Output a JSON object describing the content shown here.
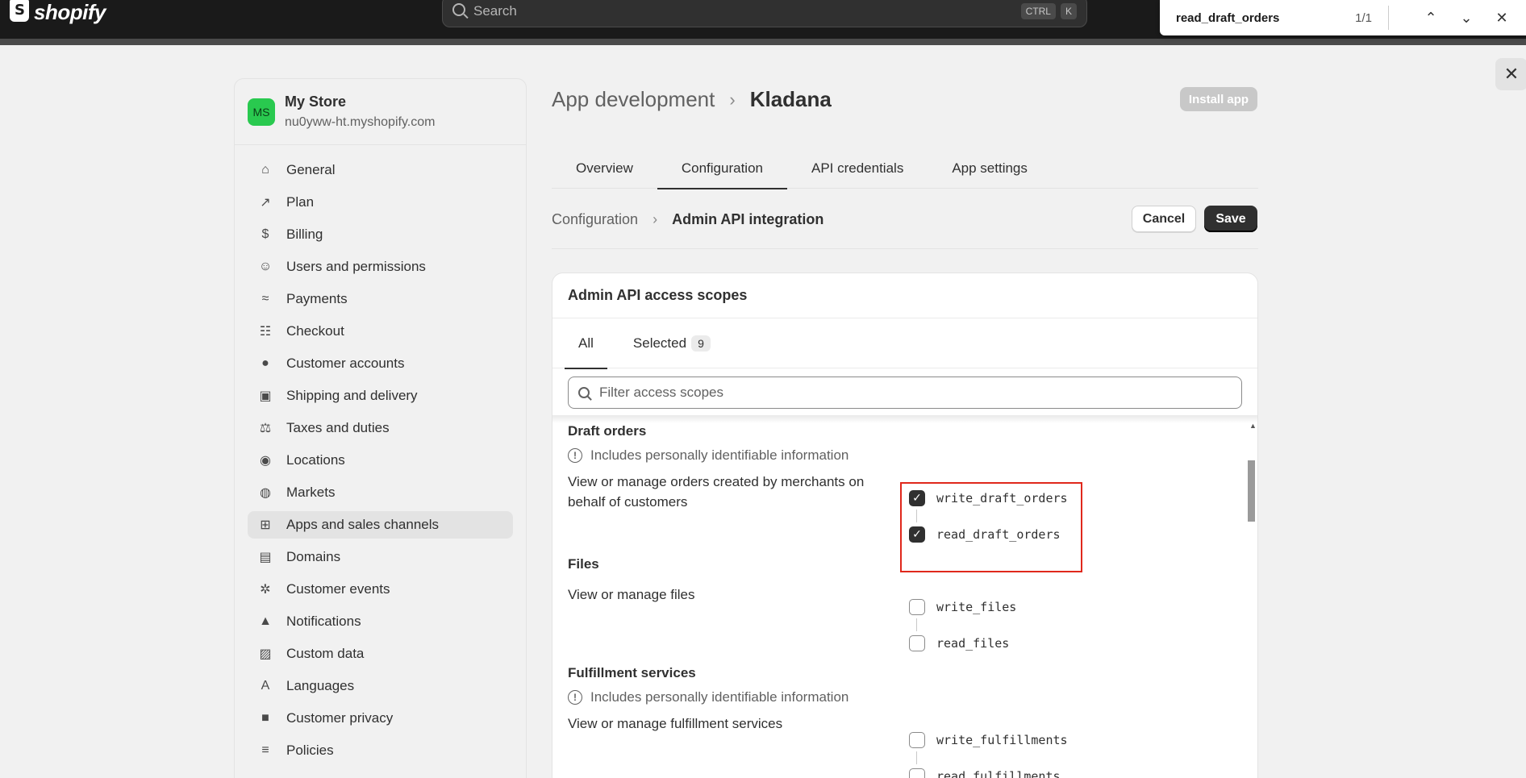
{
  "topbar": {
    "logo_text": "shopify",
    "search_placeholder": "Search",
    "shortcut_ctrl": "CTRL",
    "shortcut_key": "K"
  },
  "findbar": {
    "query": "read_draft_orders",
    "count": "1/1"
  },
  "sidebar": {
    "store_initials": "MS",
    "store_name": "My Store",
    "store_domain": "nu0yww-ht.myshopify.com",
    "items": [
      {
        "label": "General",
        "icon": "store-icon"
      },
      {
        "label": "Plan",
        "icon": "plan-icon"
      },
      {
        "label": "Billing",
        "icon": "billing-icon"
      },
      {
        "label": "Users and permissions",
        "icon": "users-icon"
      },
      {
        "label": "Payments",
        "icon": "payments-icon"
      },
      {
        "label": "Checkout",
        "icon": "cart-icon"
      },
      {
        "label": "Customer accounts",
        "icon": "person-icon"
      },
      {
        "label": "Shipping and delivery",
        "icon": "truck-icon"
      },
      {
        "label": "Taxes and duties",
        "icon": "taxes-icon"
      },
      {
        "label": "Locations",
        "icon": "location-icon"
      },
      {
        "label": "Markets",
        "icon": "globe-icon"
      },
      {
        "label": "Apps and sales channels",
        "icon": "apps-icon"
      },
      {
        "label": "Domains",
        "icon": "domains-icon"
      },
      {
        "label": "Customer events",
        "icon": "cursor-icon"
      },
      {
        "label": "Notifications",
        "icon": "bell-icon"
      },
      {
        "label": "Custom data",
        "icon": "data-icon"
      },
      {
        "label": "Languages",
        "icon": "language-icon"
      },
      {
        "label": "Customer privacy",
        "icon": "lock-icon"
      },
      {
        "label": "Policies",
        "icon": "policies-icon"
      }
    ],
    "active_item": "Apps and sales channels"
  },
  "header": {
    "crumb": "App development",
    "current": "Kladana",
    "install_label": "Install app"
  },
  "tabs": [
    "Overview",
    "Configuration",
    "API credentials",
    "App settings"
  ],
  "active_tab": "Configuration",
  "subheader": {
    "crumb": "Configuration",
    "current": "Admin API integration",
    "cancel_label": "Cancel",
    "save_label": "Save"
  },
  "card": {
    "title": "Admin API access scopes",
    "tab_all": "All",
    "tab_selected": "Selected",
    "selected_count": "9",
    "filter_placeholder": "Filter access scopes",
    "pii_text": "Includes personally identifiable information",
    "sections": [
      {
        "title": "Draft orders",
        "pii": true,
        "description": "View or manage orders created by merchants on behalf of customers",
        "scopes": [
          {
            "name": "write_draft_orders",
            "checked": true
          },
          {
            "name": "read_draft_orders",
            "checked": true
          }
        ]
      },
      {
        "title": "Files",
        "pii": false,
        "description": "View or manage files",
        "scopes": [
          {
            "name": "write_files",
            "checked": false
          },
          {
            "name": "read_files",
            "checked": false
          }
        ]
      },
      {
        "title": "Fulfillment services",
        "pii": true,
        "description": "View or manage fulfillment services",
        "scopes": [
          {
            "name": "write_fulfillments",
            "checked": false
          },
          {
            "name": "read_fulfillments",
            "checked": false
          }
        ]
      }
    ]
  },
  "colors": {
    "accent": "#303030",
    "highlight": "#e0281c",
    "avatar": "#29c94f"
  }
}
